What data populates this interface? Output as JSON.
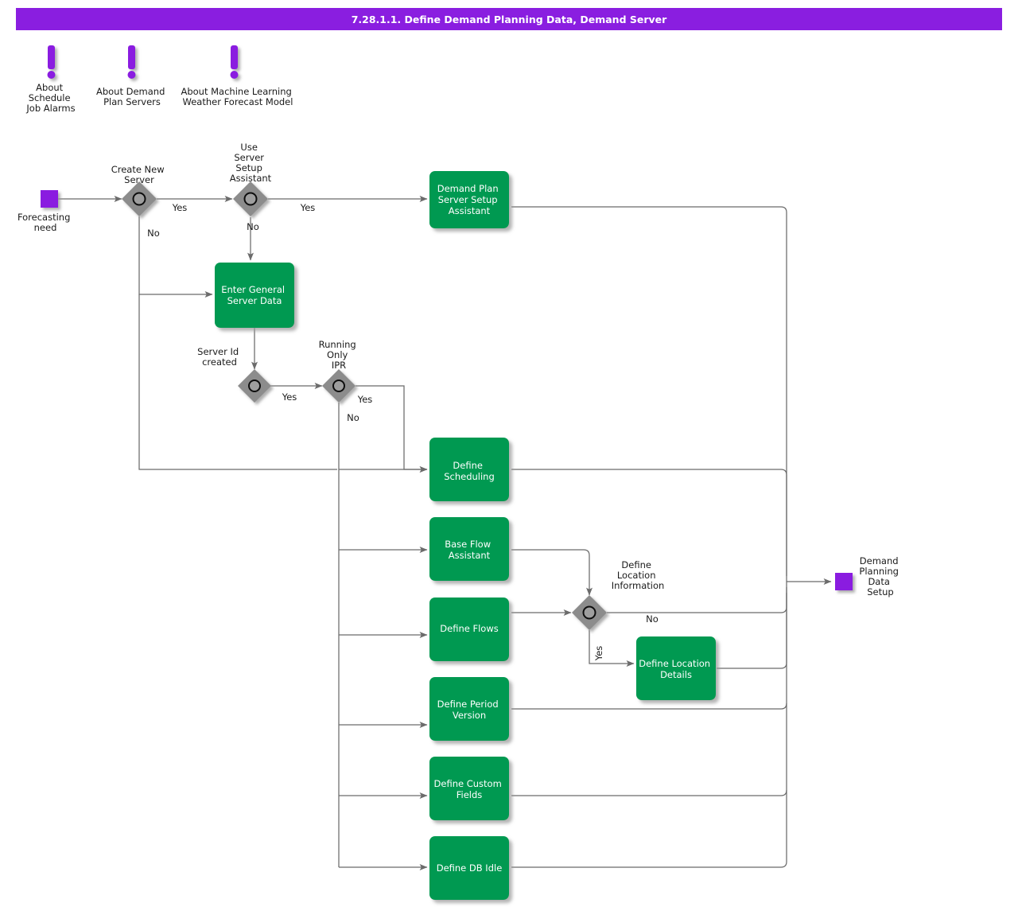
{
  "header": {
    "title": "7.28.1.1. Define Demand Planning Data, Demand Server",
    "bar_color": "#8A1EE0",
    "title_color": "#FFFFFF"
  },
  "theme": {
    "activity_fill": "#009951",
    "activity_text": "#FFFFFF",
    "terminal_fill": "#8A1EE0",
    "decision_fill": "#8C8C8C",
    "edge_color": "#6B6B6B",
    "label_color": "#1A1A1A",
    "note_color": "#8A1EE0",
    "background": "#FFFFFF"
  },
  "notes": [
    {
      "id": "note-schedule-job-alarms",
      "icon": "exclamation-note-icon",
      "label": "About\nSchedule\nJob Alarms",
      "lines": [
        "About",
        "Schedule",
        "Job Alarms"
      ]
    },
    {
      "id": "note-demand-plan-servers",
      "icon": "exclamation-note-icon",
      "label": "About Demand\nPlan Servers",
      "lines": [
        "About Demand",
        "Plan Servers"
      ]
    },
    {
      "id": "note-ml-weather-forecast",
      "icon": "exclamation-note-icon",
      "label": "About Machine Learning\nWeather Forecast Model",
      "lines": [
        "About Machine Learning",
        "Weather Forecast Model"
      ]
    }
  ],
  "terminals": [
    {
      "id": "start-forecasting-need",
      "type": "start",
      "label": "Forecasting\nneed",
      "lines": [
        "Forecasting",
        "need"
      ]
    },
    {
      "id": "end-demand-planning-data-setup",
      "type": "end",
      "label": "Demand\nPlanning\nData\nSetup",
      "lines": [
        "Demand",
        "Planning",
        "Data",
        "Setup"
      ]
    }
  ],
  "decisions": [
    {
      "id": "decision-create-new-server",
      "label": "Create New\nServer",
      "lines": [
        "Create New",
        "Server"
      ]
    },
    {
      "id": "decision-use-server-setup-assistant",
      "label": "Use\nServer\nSetup\nAssistant",
      "lines": [
        "Use",
        "Server",
        "Setup",
        "Assistant"
      ]
    },
    {
      "id": "decision-server-id-created",
      "label": "Server Id\ncreated",
      "lines": [
        "Server Id",
        "created"
      ]
    },
    {
      "id": "decision-running-only-ipr",
      "label": "Running\nOnly\nIPR",
      "lines": [
        "Running",
        "Only",
        "IPR"
      ]
    },
    {
      "id": "decision-define-location-information",
      "label": "Define\nLocation\nInformation",
      "lines": [
        "Define",
        "Location",
        "Information"
      ]
    }
  ],
  "activities": [
    {
      "id": "activity-demand-plan-server-setup-assistant",
      "label": "Demand Plan\nServer Setup\nAssistant",
      "lines": [
        "Demand Plan",
        "Server Setup",
        "Assistant"
      ]
    },
    {
      "id": "activity-enter-general-server-data",
      "label": "Enter General\nServer Data",
      "lines": [
        "Enter General",
        "Server Data"
      ]
    },
    {
      "id": "activity-define-scheduling",
      "label": "Define\nScheduling",
      "lines": [
        "Define",
        "Scheduling"
      ]
    },
    {
      "id": "activity-base-flow-assistant",
      "label": "Base Flow\nAssistant",
      "lines": [
        "Base Flow",
        "Assistant"
      ]
    },
    {
      "id": "activity-define-flows",
      "label": "Define Flows",
      "lines": [
        "Define Flows"
      ]
    },
    {
      "id": "activity-define-period-version",
      "label": "Define Period\nVersion",
      "lines": [
        "Define Period",
        "Version"
      ]
    },
    {
      "id": "activity-define-custom-fields",
      "label": "Define Custom\nFields",
      "lines": [
        "Define Custom",
        "Fields"
      ]
    },
    {
      "id": "activity-define-db-idle",
      "label": "Define DB Idle",
      "lines": [
        "Define DB Idle"
      ]
    },
    {
      "id": "activity-define-location-details",
      "label": "Define Location\nDetails",
      "lines": [
        "Define Location",
        "Details"
      ]
    }
  ],
  "edge_labels": {
    "create_new_server_yes": "Yes",
    "create_new_server_no": "No",
    "use_assistant_yes": "Yes",
    "use_assistant_no": "No",
    "server_id_created_yes": "Yes",
    "running_only_ipr_yes": "Yes",
    "running_only_ipr_no": "No",
    "location_info_no": "No",
    "location_info_yes": "Yes"
  }
}
